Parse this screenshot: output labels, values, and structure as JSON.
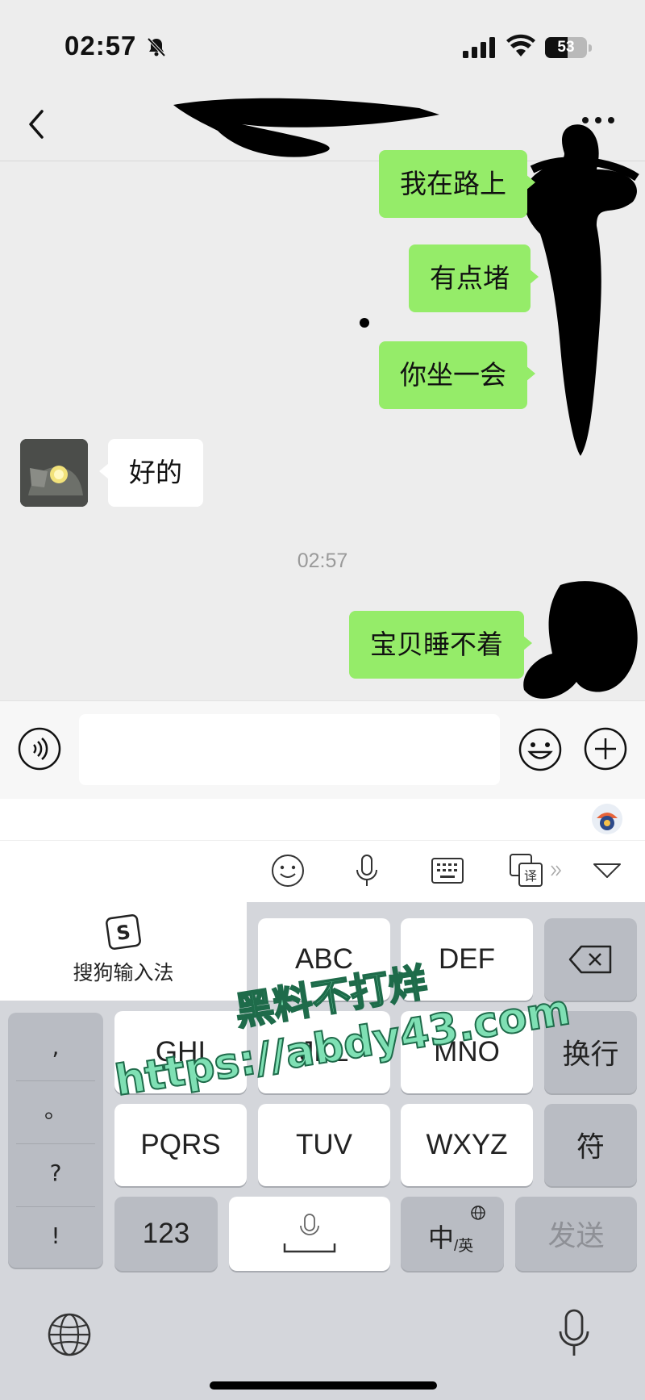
{
  "status_bar": {
    "time": "02:57",
    "battery": "53",
    "battery_level": 0.53
  },
  "chat": {
    "messages": [
      {
        "direction": "out",
        "text": "我在路上"
      },
      {
        "direction": "out",
        "text": "有点堵"
      },
      {
        "direction": "out",
        "text": "你坐一会"
      },
      {
        "direction": "in",
        "text": "好的"
      },
      {
        "direction": "out",
        "text": "宝贝睡不着"
      }
    ],
    "timestamp": "02:57"
  },
  "input": {
    "value": "",
    "placeholder": ""
  },
  "keyboard": {
    "brand_name": "搜狗输入法",
    "keys": {
      "abc": "ABC",
      "def": "DEF",
      "ghi": "GHI",
      "jkl": "JKL",
      "mno": "MNO",
      "pqrs": "PQRS",
      "tuv": "TUV",
      "wxyz": "WXYZ",
      "newline": "换行",
      "symbols": "符",
      "numbers": "123",
      "lang_main": "中",
      "lang_sub": "/英",
      "send": "发送"
    },
    "punctuation": [
      ",",
      "。",
      "?",
      "!"
    ]
  },
  "watermark": {
    "line1": "黑料不打烊",
    "line2": "https://abdy43.com"
  },
  "colors": {
    "outgoing_bubble": "#95ec69",
    "incoming_bubble": "#ffffff",
    "chat_background": "#ededed",
    "keyboard_background": "#d4d6db"
  }
}
